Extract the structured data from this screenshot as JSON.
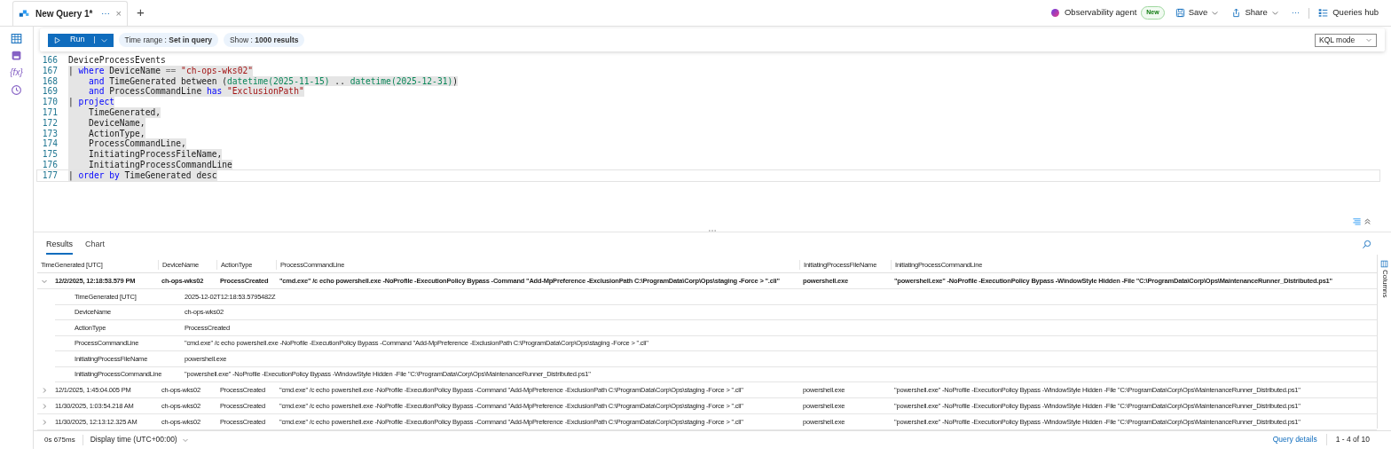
{
  "tab": {
    "title": "New Query 1*",
    "more": "⋯",
    "close": "×",
    "add": "+"
  },
  "header_actions": {
    "agent": "Observability agent",
    "badge": "New",
    "save": "Save",
    "share": "Share",
    "more": "···",
    "hub": "Queries hub"
  },
  "sidebar": [
    {
      "kind": "table"
    },
    {
      "kind": "save"
    },
    {
      "kind": "functions",
      "label": "{fx}"
    },
    {
      "kind": "history"
    }
  ],
  "toolbar": {
    "run": "Run",
    "time_range": "Time range : **Set in query**",
    "show": "Show : **1000 results**",
    "mode": "KQL mode"
  },
  "editor": {
    "lines": [
      {
        "number": "166",
        "selected": false,
        "current": false,
        "indent": false,
        "tokens": [
          {
            "kind": "plain",
            "text": "DeviceProcessEvents"
          }
        ]
      },
      {
        "number": "167",
        "selected": true,
        "current": false,
        "indent": false,
        "tokens": [
          {
            "kind": "plain",
            "text": "| "
          },
          {
            "kind": "keyword",
            "text": "where"
          },
          {
            "kind": "plain",
            "text": " DeviceName "
          },
          {
            "kind": "op",
            "text": "=="
          },
          {
            "kind": "string",
            "text": " \"ch-ops-wks02\""
          }
        ]
      },
      {
        "number": "168",
        "selected": true,
        "current": false,
        "indent": true,
        "tokens": [
          {
            "kind": "keyword",
            "text": "and"
          },
          {
            "kind": "plain",
            "text": " TimeGenerated between ("
          },
          {
            "kind": "func",
            "text": "datetime(2025-11-15)"
          },
          {
            "kind": "plain",
            "text": " .. "
          },
          {
            "kind": "func",
            "text": "datetime(2025-12-31)"
          },
          {
            "kind": "plain",
            "text": ")"
          }
        ]
      },
      {
        "number": "169",
        "selected": true,
        "current": false,
        "indent": true,
        "tokens": [
          {
            "kind": "keyword",
            "text": "and"
          },
          {
            "kind": "plain",
            "text": " ProcessCommandLine "
          },
          {
            "kind": "keyword",
            "text": "has"
          },
          {
            "kind": "string",
            "text": " \"ExclusionPath\""
          }
        ]
      },
      {
        "number": "170",
        "selected": true,
        "current": false,
        "indent": false,
        "tokens": [
          {
            "kind": "plain",
            "text": "| "
          },
          {
            "kind": "keyword",
            "text": "project"
          }
        ]
      },
      {
        "number": "171",
        "selected": true,
        "current": false,
        "indent": true,
        "tokens": [
          {
            "kind": "plain",
            "text": "TimeGenerated,"
          }
        ]
      },
      {
        "number": "172",
        "selected": true,
        "current": false,
        "indent": true,
        "tokens": [
          {
            "kind": "plain",
            "text": "DeviceName,"
          }
        ]
      },
      {
        "number": "173",
        "selected": true,
        "current": false,
        "indent": true,
        "tokens": [
          {
            "kind": "plain",
            "text": "ActionType,"
          }
        ]
      },
      {
        "number": "174",
        "selected": true,
        "current": false,
        "indent": true,
        "tokens": [
          {
            "kind": "plain",
            "text": "ProcessCommandLine,"
          }
        ]
      },
      {
        "number": "175",
        "selected": true,
        "current": false,
        "indent": true,
        "tokens": [
          {
            "kind": "plain",
            "text": "InitiatingProcessFileName,"
          }
        ]
      },
      {
        "number": "176",
        "selected": true,
        "current": false,
        "indent": true,
        "tokens": [
          {
            "kind": "plain",
            "text": "InitiatingProcessCommandLine"
          }
        ]
      },
      {
        "number": "177",
        "selected": true,
        "current": true,
        "indent": false,
        "tokens": [
          {
            "kind": "plain",
            "text": "| "
          },
          {
            "kind": "keyword",
            "text": "order by"
          },
          {
            "kind": "plain",
            "text": " TimeGenerated desc"
          }
        ]
      }
    ]
  },
  "results_tabs": [
    {
      "label": "Results",
      "selected": true
    },
    {
      "label": "Chart",
      "selected": false
    }
  ],
  "table": {
    "columns": [
      "TimeGenerated [UTC]",
      "DeviceName",
      "ActionType",
      "ProcessCommandLine",
      "InitiatingProcessFileName",
      "InitiatingProcessCommandLine"
    ],
    "rows": [
      {
        "expanded": true,
        "cells": [
          "12/2/2025, 12:18:53.579 PM",
          "ch-ops-wks02",
          "ProcessCreated",
          "\"cmd.exe\" /c echo powershell.exe -NoProfile -ExecutionPolicy Bypass -Command \"Add-MpPreference -ExclusionPath C:\\ProgramData\\Corp\\Ops\\staging -Force > \".cli\"",
          "powershell.exe",
          "\"powershell.exe\" -NoProfile -ExecutionPolicy Bypass -WindowStyle Hidden -File \"C:\\ProgramData\\Corp\\Ops\\MaintenanceRunner_Distributed.ps1\""
        ],
        "details": [
          {
            "label": "TimeGenerated [UTC]",
            "value": "2025-12-02T12:18:53.5795482Z"
          },
          {
            "label": "DeviceName",
            "value": "ch-ops-wks02"
          },
          {
            "label": "ActionType",
            "value": "ProcessCreated"
          },
          {
            "label": "ProcessCommandLine",
            "value": "\"cmd.exe\" /c echo powershell.exe -NoProfile -ExecutionPolicy Bypass -Command \"Add-MpPreference -ExclusionPath C:\\ProgramData\\Corp\\Ops\\staging -Force > \".cli\""
          },
          {
            "label": "InitiatingProcessFileName",
            "value": "powershell.exe"
          },
          {
            "label": "InitiatingProcessCommandLine",
            "value": "\"powershell.exe\" -NoProfile -ExecutionPolicy Bypass -WindowStyle Hidden -File \"C:\\ProgramData\\Corp\\Ops\\MaintenanceRunner_Distributed.ps1\""
          }
        ]
      },
      {
        "expanded": false,
        "cells": [
          "12/1/2025, 1:45:04.005 PM",
          "ch-ops-wks02",
          "ProcessCreated",
          "\"cmd.exe\" /c echo powershell.exe -NoProfile -ExecutionPolicy Bypass -Command \"Add-MpPreference -ExclusionPath C:\\ProgramData\\Corp\\Ops\\staging -Force > \".cli\"",
          "powershell.exe",
          "\"powershell.exe\" -NoProfile -ExecutionPolicy Bypass -WindowStyle Hidden -File \"C:\\ProgramData\\Corp\\Ops\\MaintenanceRunner_Distributed.ps1\""
        ]
      },
      {
        "expanded": false,
        "cells": [
          "11/30/2025, 1:03:54.218 AM",
          "ch-ops-wks02",
          "ProcessCreated",
          "\"cmd.exe\" /c echo powershell.exe -NoProfile -ExecutionPolicy Bypass -Command \"Add-MpPreference -ExclusionPath C:\\ProgramData\\Corp\\Ops\\staging -Force > \".cli\"",
          "powershell.exe",
          "\"powershell.exe\" -NoProfile -ExecutionPolicy Bypass -WindowStyle Hidden -File \"C:\\ProgramData\\Corp\\Ops\\MaintenanceRunner_Distributed.ps1\""
        ]
      },
      {
        "expanded": false,
        "cells": [
          "11/30/2025, 12:13:12.325 AM",
          "ch-ops-wks02",
          "ProcessCreated",
          "\"cmd.exe\" /c echo powershell.exe -NoProfile -ExecutionPolicy Bypass -Command \"Add-MpPreference -ExclusionPath C:\\ProgramData\\Corp\\Ops\\staging -Force > \".cli\"",
          "powershell.exe",
          "\"powershell.exe\" -NoProfile -ExecutionPolicy Bypass -WindowStyle Hidden -File \"C:\\ProgramData\\Corp\\Ops\\MaintenanceRunner_Distributed.ps1\""
        ]
      }
    ]
  },
  "columns_panel": "Columns",
  "status_bar": {
    "duration": "0s 675ms",
    "display_time": "Display time (UTC+00:00)",
    "details": "Query details",
    "paging": "1 - 4 of 10"
  }
}
